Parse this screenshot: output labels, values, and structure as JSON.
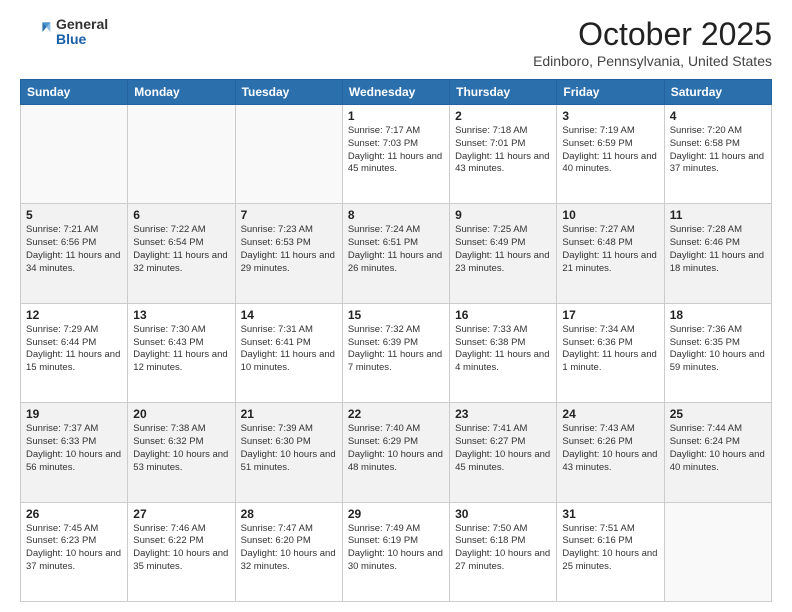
{
  "header": {
    "logo_general": "General",
    "logo_blue": "Blue",
    "month_title": "October 2025",
    "location": "Edinboro, Pennsylvania, United States"
  },
  "days_of_week": [
    "Sunday",
    "Monday",
    "Tuesday",
    "Wednesday",
    "Thursday",
    "Friday",
    "Saturday"
  ],
  "weeks": [
    [
      {
        "day": "",
        "info": ""
      },
      {
        "day": "",
        "info": ""
      },
      {
        "day": "",
        "info": ""
      },
      {
        "day": "1",
        "info": "Sunrise: 7:17 AM\nSunset: 7:03 PM\nDaylight: 11 hours and 45 minutes."
      },
      {
        "day": "2",
        "info": "Sunrise: 7:18 AM\nSunset: 7:01 PM\nDaylight: 11 hours and 43 minutes."
      },
      {
        "day": "3",
        "info": "Sunrise: 7:19 AM\nSunset: 6:59 PM\nDaylight: 11 hours and 40 minutes."
      },
      {
        "day": "4",
        "info": "Sunrise: 7:20 AM\nSunset: 6:58 PM\nDaylight: 11 hours and 37 minutes."
      }
    ],
    [
      {
        "day": "5",
        "info": "Sunrise: 7:21 AM\nSunset: 6:56 PM\nDaylight: 11 hours and 34 minutes."
      },
      {
        "day": "6",
        "info": "Sunrise: 7:22 AM\nSunset: 6:54 PM\nDaylight: 11 hours and 32 minutes."
      },
      {
        "day": "7",
        "info": "Sunrise: 7:23 AM\nSunset: 6:53 PM\nDaylight: 11 hours and 29 minutes."
      },
      {
        "day": "8",
        "info": "Sunrise: 7:24 AM\nSunset: 6:51 PM\nDaylight: 11 hours and 26 minutes."
      },
      {
        "day": "9",
        "info": "Sunrise: 7:25 AM\nSunset: 6:49 PM\nDaylight: 11 hours and 23 minutes."
      },
      {
        "day": "10",
        "info": "Sunrise: 7:27 AM\nSunset: 6:48 PM\nDaylight: 11 hours and 21 minutes."
      },
      {
        "day": "11",
        "info": "Sunrise: 7:28 AM\nSunset: 6:46 PM\nDaylight: 11 hours and 18 minutes."
      }
    ],
    [
      {
        "day": "12",
        "info": "Sunrise: 7:29 AM\nSunset: 6:44 PM\nDaylight: 11 hours and 15 minutes."
      },
      {
        "day": "13",
        "info": "Sunrise: 7:30 AM\nSunset: 6:43 PM\nDaylight: 11 hours and 12 minutes."
      },
      {
        "day": "14",
        "info": "Sunrise: 7:31 AM\nSunset: 6:41 PM\nDaylight: 11 hours and 10 minutes."
      },
      {
        "day": "15",
        "info": "Sunrise: 7:32 AM\nSunset: 6:39 PM\nDaylight: 11 hours and 7 minutes."
      },
      {
        "day": "16",
        "info": "Sunrise: 7:33 AM\nSunset: 6:38 PM\nDaylight: 11 hours and 4 minutes."
      },
      {
        "day": "17",
        "info": "Sunrise: 7:34 AM\nSunset: 6:36 PM\nDaylight: 11 hours and 1 minute."
      },
      {
        "day": "18",
        "info": "Sunrise: 7:36 AM\nSunset: 6:35 PM\nDaylight: 10 hours and 59 minutes."
      }
    ],
    [
      {
        "day": "19",
        "info": "Sunrise: 7:37 AM\nSunset: 6:33 PM\nDaylight: 10 hours and 56 minutes."
      },
      {
        "day": "20",
        "info": "Sunrise: 7:38 AM\nSunset: 6:32 PM\nDaylight: 10 hours and 53 minutes."
      },
      {
        "day": "21",
        "info": "Sunrise: 7:39 AM\nSunset: 6:30 PM\nDaylight: 10 hours and 51 minutes."
      },
      {
        "day": "22",
        "info": "Sunrise: 7:40 AM\nSunset: 6:29 PM\nDaylight: 10 hours and 48 minutes."
      },
      {
        "day": "23",
        "info": "Sunrise: 7:41 AM\nSunset: 6:27 PM\nDaylight: 10 hours and 45 minutes."
      },
      {
        "day": "24",
        "info": "Sunrise: 7:43 AM\nSunset: 6:26 PM\nDaylight: 10 hours and 43 minutes."
      },
      {
        "day": "25",
        "info": "Sunrise: 7:44 AM\nSunset: 6:24 PM\nDaylight: 10 hours and 40 minutes."
      }
    ],
    [
      {
        "day": "26",
        "info": "Sunrise: 7:45 AM\nSunset: 6:23 PM\nDaylight: 10 hours and 37 minutes."
      },
      {
        "day": "27",
        "info": "Sunrise: 7:46 AM\nSunset: 6:22 PM\nDaylight: 10 hours and 35 minutes."
      },
      {
        "day": "28",
        "info": "Sunrise: 7:47 AM\nSunset: 6:20 PM\nDaylight: 10 hours and 32 minutes."
      },
      {
        "day": "29",
        "info": "Sunrise: 7:49 AM\nSunset: 6:19 PM\nDaylight: 10 hours and 30 minutes."
      },
      {
        "day": "30",
        "info": "Sunrise: 7:50 AM\nSunset: 6:18 PM\nDaylight: 10 hours and 27 minutes."
      },
      {
        "day": "31",
        "info": "Sunrise: 7:51 AM\nSunset: 6:16 PM\nDaylight: 10 hours and 25 minutes."
      },
      {
        "day": "",
        "info": ""
      }
    ]
  ]
}
